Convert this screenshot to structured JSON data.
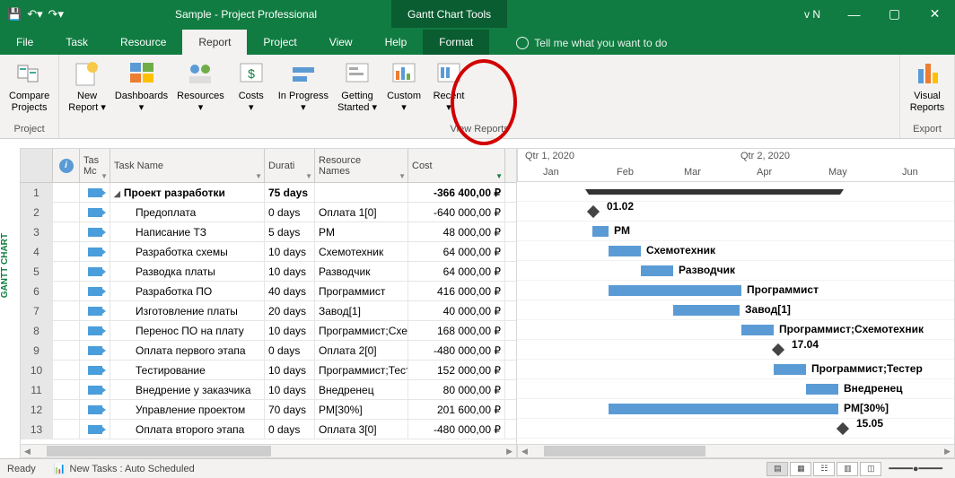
{
  "window": {
    "title": "Sample  -  Project Professional",
    "tool_tab": "Gantt Chart Tools",
    "version": "v N",
    "tellme": "Tell me what you want to do"
  },
  "menu": {
    "file": "File",
    "task": "Task",
    "resource": "Resource",
    "report": "Report",
    "project": "Project",
    "view": "View",
    "help": "Help",
    "format": "Format"
  },
  "ribbon": {
    "group_project": "Project",
    "group_view": "View Reports",
    "group_export": "Export",
    "compare": "Compare\nProjects",
    "new": "New\nReport ▾",
    "dash": "Dashboards\n▾",
    "resources": "Resources\n▾",
    "costs": "Costs\n▾",
    "inprog": "In Progress\n▾",
    "getting": "Getting\nStarted ▾",
    "custom": "Custom\n▾",
    "recent": "Recent\n▾",
    "visual": "Visual\nReports"
  },
  "timeline": {
    "q1": "Qtr 1, 2020",
    "q2": "Qtr 2, 2020",
    "jan": "Jan",
    "feb": "Feb",
    "mar": "Mar",
    "apr": "Apr",
    "may": "May",
    "jun": "Jun"
  },
  "grid": {
    "headers": {
      "mode": "Tas\nMc",
      "name": "Task Name",
      "dur": "Durati",
      "res": "Resource\nNames",
      "cost": "Cost"
    },
    "rows": [
      {
        "n": 1,
        "name": "Проект разработки",
        "dur": "75 days",
        "res": "",
        "cost": "-366 400,00 ₽",
        "summary": true
      },
      {
        "n": 2,
        "name": "Предоплата",
        "dur": "0 days",
        "res": "Оплата 1[0]",
        "cost": "-640 000,00 ₽"
      },
      {
        "n": 3,
        "name": "Написание ТЗ",
        "dur": "5 days",
        "res": "PM",
        "cost": "48 000,00 ₽"
      },
      {
        "n": 4,
        "name": "Разработка схемы",
        "dur": "10 days",
        "res": "Схемотехник",
        "cost": "64 000,00 ₽"
      },
      {
        "n": 5,
        "name": "Разводка платы",
        "dur": "10 days",
        "res": "Разводчик",
        "cost": "64 000,00 ₽"
      },
      {
        "n": 6,
        "name": "Разработка ПО",
        "dur": "40 days",
        "res": "Программист",
        "cost": "416 000,00 ₽"
      },
      {
        "n": 7,
        "name": "Изготовление платы",
        "dur": "20 days",
        "res": "Завод[1]",
        "cost": "40 000,00 ₽"
      },
      {
        "n": 8,
        "name": "Перенос ПО на плату",
        "dur": "10 days",
        "res": "Программист;Схемотехник",
        "cost": "168 000,00 ₽"
      },
      {
        "n": 9,
        "name": "Оплата первого этапа",
        "dur": "0 days",
        "res": "Оплата 2[0]",
        "cost": "-480 000,00 ₽"
      },
      {
        "n": 10,
        "name": "Тестирование",
        "dur": "10 days",
        "res": "Программист;Тестер",
        "cost": "152 000,00 ₽"
      },
      {
        "n": 11,
        "name": "Внедрение у заказчика",
        "dur": "10 days",
        "res": "Внедренец",
        "cost": "80 000,00 ₽"
      },
      {
        "n": 12,
        "name": "Управление проектом",
        "dur": "70 days",
        "res": "PM[30%]",
        "cost": "201 600,00 ₽"
      },
      {
        "n": 13,
        "name": "Оплата второго этапа",
        "dur": "0 days",
        "res": "Оплата 3[0]",
        "cost": "-480 000,00 ₽"
      }
    ]
  },
  "gantt_labels": {
    "r2": "01.02",
    "r3": "PM",
    "r4": "Схемотехник",
    "r5": "Разводчик",
    "r6": "Программист",
    "r7": "Завод[1]",
    "r8": "Программист;Схемотехник",
    "r9": "17.04",
    "r10": "Программист;Тестер",
    "r11": "Внедренец",
    "r12": "PM[30%]",
    "r13": "15.05"
  },
  "status": {
    "ready": "Ready",
    "newtasks": "New Tasks : Auto Scheduled"
  },
  "side": "GANTT CHART"
}
